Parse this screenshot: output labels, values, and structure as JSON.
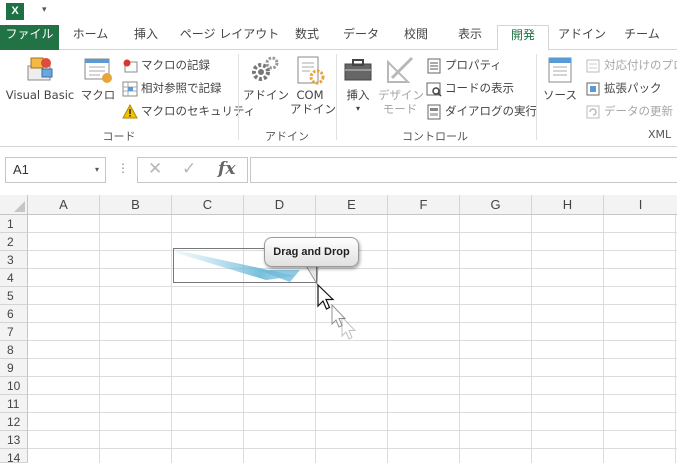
{
  "app": {
    "logo_letter": "X",
    "qa_arrow": "▾"
  },
  "tabs": [
    {
      "label": "ファイル"
    },
    {
      "label": "ホーム"
    },
    {
      "label": "挿入"
    },
    {
      "label": "ページ レイアウト"
    },
    {
      "label": "数式"
    },
    {
      "label": "データ"
    },
    {
      "label": "校閲"
    },
    {
      "label": "表示"
    },
    {
      "label": "開発"
    },
    {
      "label": "アドイン"
    },
    {
      "label": "チーム"
    }
  ],
  "active_tab": "開発",
  "ribbon": {
    "code": {
      "label": "コード",
      "visual_basic": "Visual Basic",
      "macro": "マクロ",
      "record_macro": "マクロの記録",
      "relative_ref": "相対参照で記録",
      "macro_security": "マクロのセキュリティ"
    },
    "addins": {
      "label": "アドイン",
      "addin": "アドイン",
      "com_line1": "COM",
      "com_line2": "アドイン"
    },
    "controls": {
      "label": "コントロール",
      "insert": "挿入",
      "insert_arrow": "▾",
      "design_line1": "デザイン",
      "design_line2": "モード",
      "properties": "プロパティ",
      "view_code": "コードの表示",
      "run_dialog": "ダイアログの実行"
    },
    "xml": {
      "label": "XML",
      "source": "ソース",
      "map_properties": "対応付けのプロ",
      "expansion_packs": "拡張パック",
      "refresh_data": "データの更新"
    }
  },
  "formula_bar": {
    "name_box": "A1",
    "name_box_arrow": "▾",
    "dots": "⋮",
    "cancel": "✕",
    "enter": "✓",
    "fx": "fx",
    "value": ""
  },
  "grid": {
    "columns": [
      "A",
      "B",
      "C",
      "D",
      "E",
      "F",
      "G",
      "H",
      "I"
    ],
    "rows": [
      "1",
      "2",
      "3",
      "4",
      "5",
      "6",
      "7",
      "8",
      "9",
      "10",
      "11",
      "12",
      "13",
      "14"
    ]
  },
  "overlay": {
    "callout": "Drag and Drop"
  },
  "colors": {
    "excel_green": "#217346",
    "logo_green": "#1e7145",
    "grid_line": "#dadcdd",
    "header_bg": "#f3f3f3"
  }
}
